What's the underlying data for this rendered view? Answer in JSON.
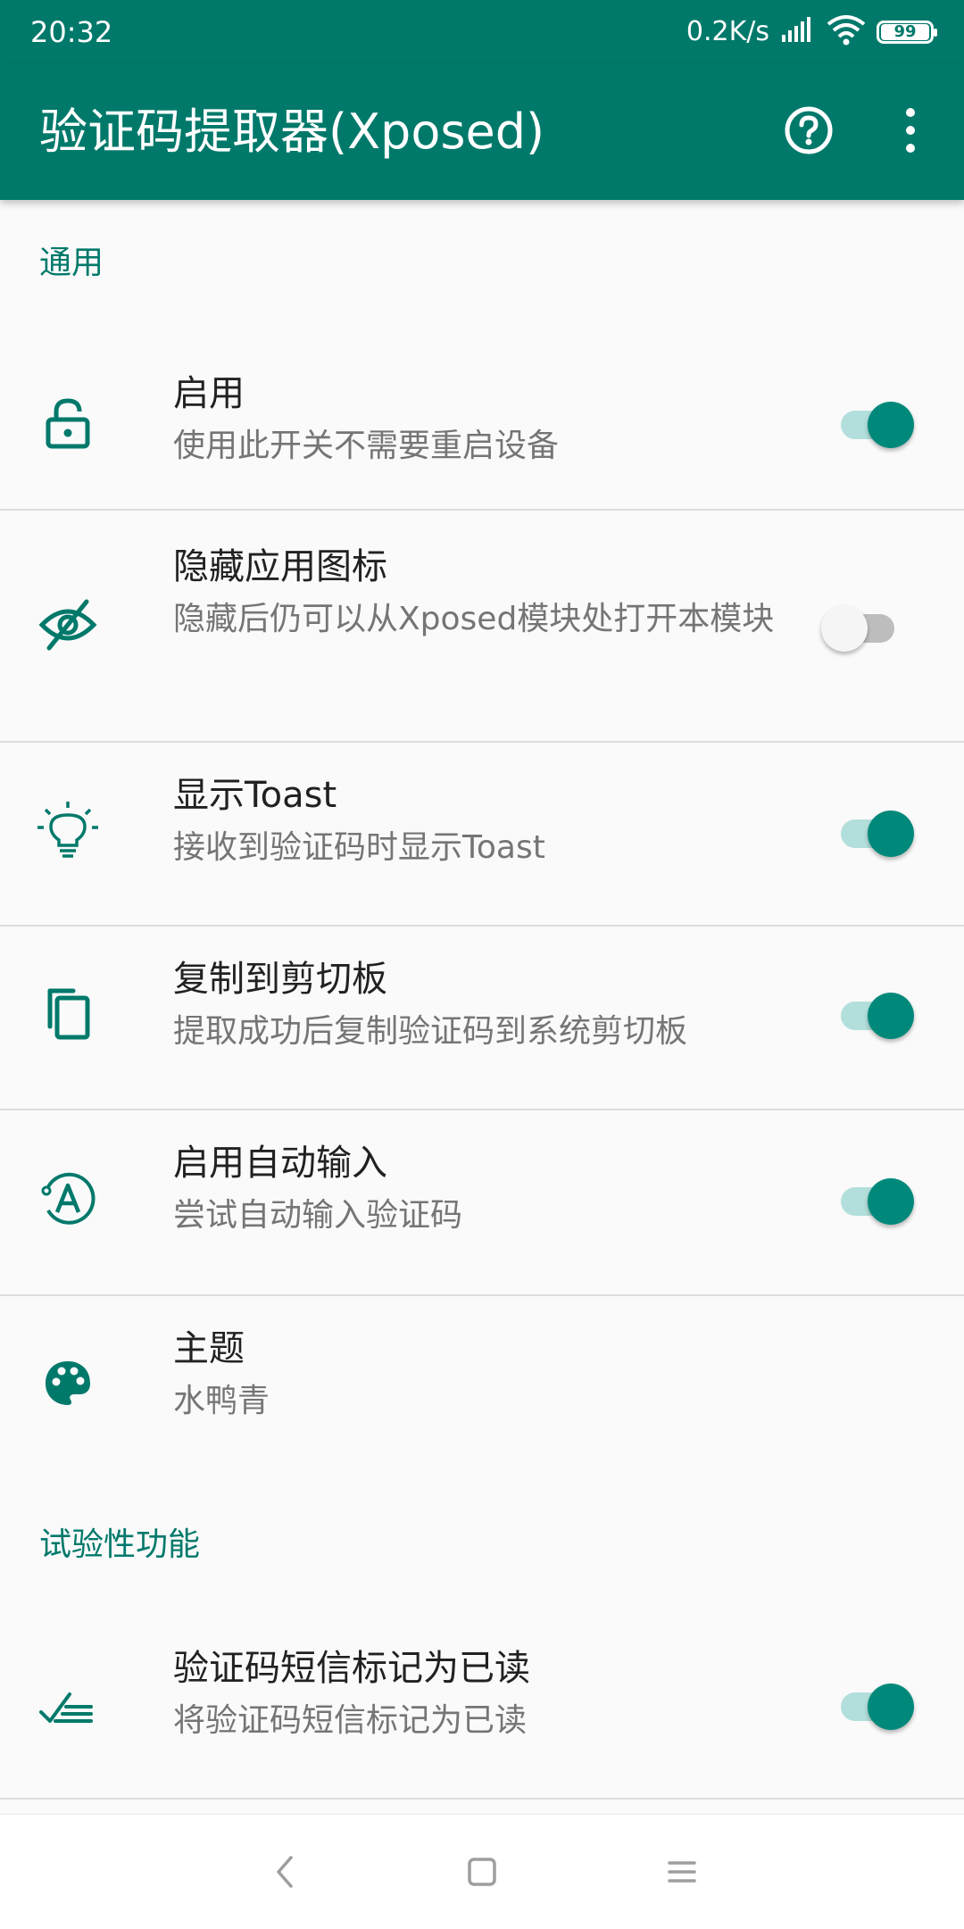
{
  "status_bar": {
    "time": "20:32",
    "net_speed": "0.2K/s",
    "battery": "99"
  },
  "app_bar": {
    "title": "验证码提取器(Xposed)",
    "icons": [
      "help-icon",
      "overflow-menu-icon"
    ]
  },
  "sections": {
    "general": {
      "header": "通用",
      "items": [
        {
          "title": "启用",
          "summary": "使用此开关不需要重启设备",
          "icon": "lock-open-icon",
          "switch": true
        },
        {
          "title": "隐藏应用图标",
          "summary": "隐藏后仍可以从Xposed模块处打开本模块",
          "icon": "eye-off-icon",
          "switch": false
        },
        {
          "title": "显示Toast",
          "summary": "接收到验证码时显示Toast",
          "icon": "lightbulb-icon",
          "switch": true
        },
        {
          "title": "复制到剪切板",
          "summary": "提取成功后复制验证码到系统剪切板",
          "icon": "copy-icon",
          "switch": true
        },
        {
          "title": "启用自动输入",
          "summary": "尝试自动输入验证码",
          "icon": "auto-input-icon",
          "switch": true
        },
        {
          "title": "主题",
          "summary": "水鸭青",
          "icon": "palette-icon"
        }
      ]
    },
    "experimental": {
      "header": "试验性功能",
      "items": [
        {
          "title": "验证码短信标记为已读",
          "summary": "将验证码短信标记为已读",
          "icon": "mark-read-icon",
          "switch": true
        }
      ]
    }
  },
  "nav_bar": {
    "icons": [
      "back-icon",
      "home-icon",
      "recents-icon"
    ]
  },
  "colors": {
    "primary": "#00796b",
    "accent": "#00897b",
    "track_on": "#b2dfdb",
    "track_off": "#bdbdbd"
  }
}
